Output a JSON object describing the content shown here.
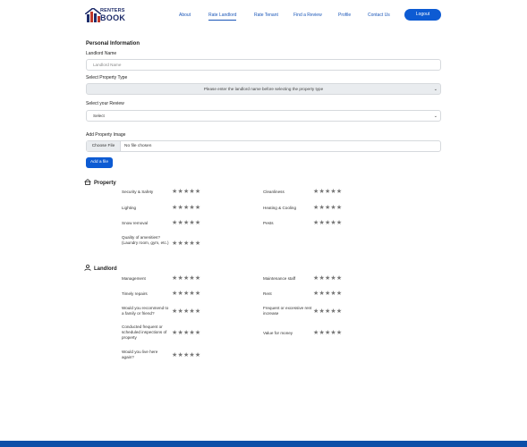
{
  "header": {
    "logo_top": "RENTERS",
    "logo_bottom": "BOOK",
    "nav": [
      "About",
      "Rate Landlord",
      "Rate Tenant",
      "Find a Review",
      "Profile",
      "Contact Us"
    ],
    "logout": "Logout"
  },
  "form": {
    "section_title": "Personal Information",
    "landlord_name_label": "Landlord Name",
    "landlord_name_placeholder": "Landlord Name",
    "property_type_label": "Select Property Type",
    "property_type_value": "Please enter the landlord name before selecting the property type",
    "review_label": "Select your Review",
    "review_value": "Select",
    "image_label": "Add Property Image",
    "choose_file": "Choose File",
    "no_file": "No file chosen",
    "add_file": "Add a file"
  },
  "property": {
    "title": "Property",
    "items": [
      {
        "label": "Security & Safety",
        "stars": "★★★★★"
      },
      {
        "label": "Cleanliness",
        "stars": "★★★★★"
      },
      {
        "label": "Lighting",
        "stars": "★★★★★"
      },
      {
        "label": "Heating & Cooling",
        "stars": "★★★★★"
      },
      {
        "label": "Snow removal",
        "stars": "★★★★★"
      },
      {
        "label": "Pests",
        "stars": "★★★★★"
      },
      {
        "label": "Quality of amenities? (Laundry room, gym, etc.)",
        "stars": "★★★★★"
      }
    ]
  },
  "landlord": {
    "title": "Landlord",
    "items": [
      {
        "label": "Management",
        "stars": "★★★★★"
      },
      {
        "label": "Maintenance staff",
        "stars": "★★★★★"
      },
      {
        "label": "Timely repairs",
        "stars": "★★★★★"
      },
      {
        "label": "Rent",
        "stars": "★★★★★"
      },
      {
        "label": "Would you recommend to a family or friend?",
        "stars": "★★★★★"
      },
      {
        "label": "Frequent or excessive rent increase",
        "stars": "★★★★★"
      },
      {
        "label": "Conducted frequent or scheduled inspections of property",
        "stars": "★★★★★"
      },
      {
        "label": "Value for money",
        "stars": "★★★★★"
      },
      {
        "label": "Would you live here again?",
        "stars": "★★★★★"
      }
    ]
  },
  "colors": {
    "accent": "#0d5bd3",
    "nav_text": "#1a56b8",
    "footer": "#0d4fa8",
    "star": "#777777"
  }
}
